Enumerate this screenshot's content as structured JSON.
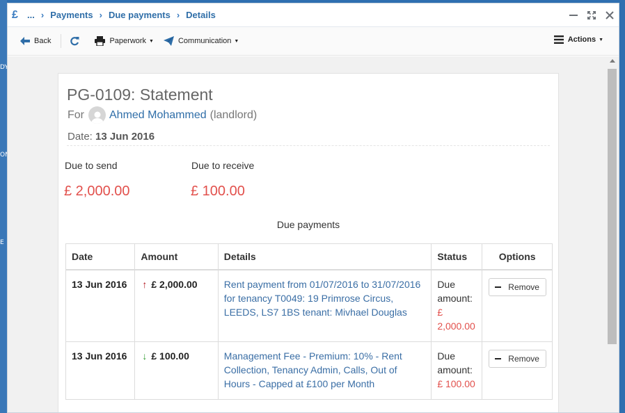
{
  "background": {
    "edge_texts": [
      "DY",
      "ON",
      "E"
    ]
  },
  "titlebar": {
    "app_icon": "£",
    "breadcrumbs": [
      "...",
      "Payments",
      "Due payments",
      "Details"
    ]
  },
  "toolbar": {
    "back_label": "Back",
    "paperwork_label": "Paperwork",
    "communication_label": "Communication",
    "actions_label": "Actions"
  },
  "statement": {
    "title": "PG-0109: Statement",
    "for_prefix": "For",
    "person_name": "Ahmed Mohammed",
    "person_role": "(landlord)",
    "date_label": "Date:",
    "date_value": "13 Jun 2016",
    "due_to_send_label": "Due to send",
    "due_to_send_value": "£ 2,000.00",
    "due_to_receive_label": "Due to receive",
    "due_to_receive_value": "£ 100.00"
  },
  "due_payments": {
    "caption": "Due payments",
    "headers": {
      "date": "Date",
      "amount": "Amount",
      "details": "Details",
      "status": "Status",
      "options": "Options"
    },
    "rows": [
      {
        "date": "13 Jun 2016",
        "direction": "up",
        "amount": "£ 2,000.00",
        "details": "Rent payment from 01/07/2016 to 31/07/2016 for tenancy T0049: 19 Primrose Circus, LEEDS, LS7 1BS tenant: Mivhael Douglas",
        "status_label": "Due amount:",
        "status_amount": "£ 2,000.00",
        "option_label": "Remove"
      },
      {
        "date": "13 Jun 2016",
        "direction": "down",
        "amount": "£ 100.00",
        "details": "Management Fee - Premium: 10% - Rent Collection, Tenancy Admin, Calls, Out of Hours - Capped at £100 per Month",
        "status_label": "Due amount:",
        "status_amount": "£ 100.00",
        "option_label": "Remove"
      }
    ]
  },
  "colors": {
    "accent": "#2f6ea8",
    "negative": "#e2504c",
    "up_arrow": "#b0121b",
    "down_arrow": "#2e9a2e"
  }
}
